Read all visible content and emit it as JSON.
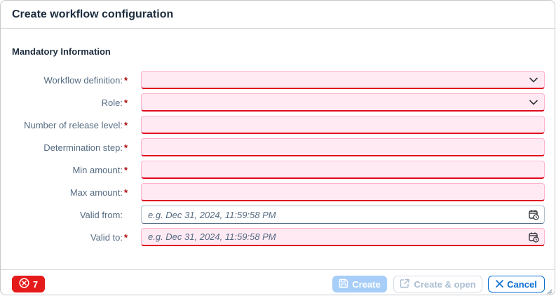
{
  "dialog": {
    "title": "Create workflow configuration"
  },
  "section": {
    "title": "Mandatory Information"
  },
  "fields": [
    {
      "label": "Workflow definition:",
      "required": "*",
      "value": "",
      "placeholder": "",
      "type": "select",
      "state": "error"
    },
    {
      "label": "Role:",
      "required": "*",
      "value": "",
      "placeholder": "",
      "type": "select",
      "state": "error"
    },
    {
      "label": "Number of release level:",
      "required": "*",
      "value": "",
      "placeholder": "",
      "type": "input",
      "state": "error"
    },
    {
      "label": "Determination step:",
      "required": "*",
      "value": "",
      "placeholder": "",
      "type": "input",
      "state": "error"
    },
    {
      "label": "Min amount:",
      "required": "*",
      "value": "",
      "placeholder": "",
      "type": "input",
      "state": "error"
    },
    {
      "label": "Max amount:",
      "required": "*",
      "value": "",
      "placeholder": "",
      "type": "input",
      "state": "error"
    },
    {
      "label": "Valid from:",
      "required": "",
      "value": "",
      "placeholder": "e.g. Dec 31, 2024, 11:59:58 PM",
      "type": "datetime",
      "state": "normal"
    },
    {
      "label": "Valid to:",
      "required": "*",
      "value": "",
      "placeholder": "e.g. Dec 31, 2024, 11:59:58 PM",
      "type": "datetime",
      "state": "error"
    }
  ],
  "footer": {
    "error_count": "7",
    "create_label": "Create",
    "create_open_label": "Create & open",
    "cancel_label": "Cancel"
  },
  "icons": {
    "dropdown": "chevron-down-icon",
    "datetime": "calendar-clock-icon",
    "error": "error-circle-icon",
    "create": "save-icon",
    "create_open": "open-in-new-icon",
    "cancel": "close-icon"
  },
  "colors": {
    "error_red": "#e00a1f",
    "error_bg": "#ffeaf4",
    "brand_blue": "#0a6ed1",
    "badge_red": "#e51b1b"
  }
}
